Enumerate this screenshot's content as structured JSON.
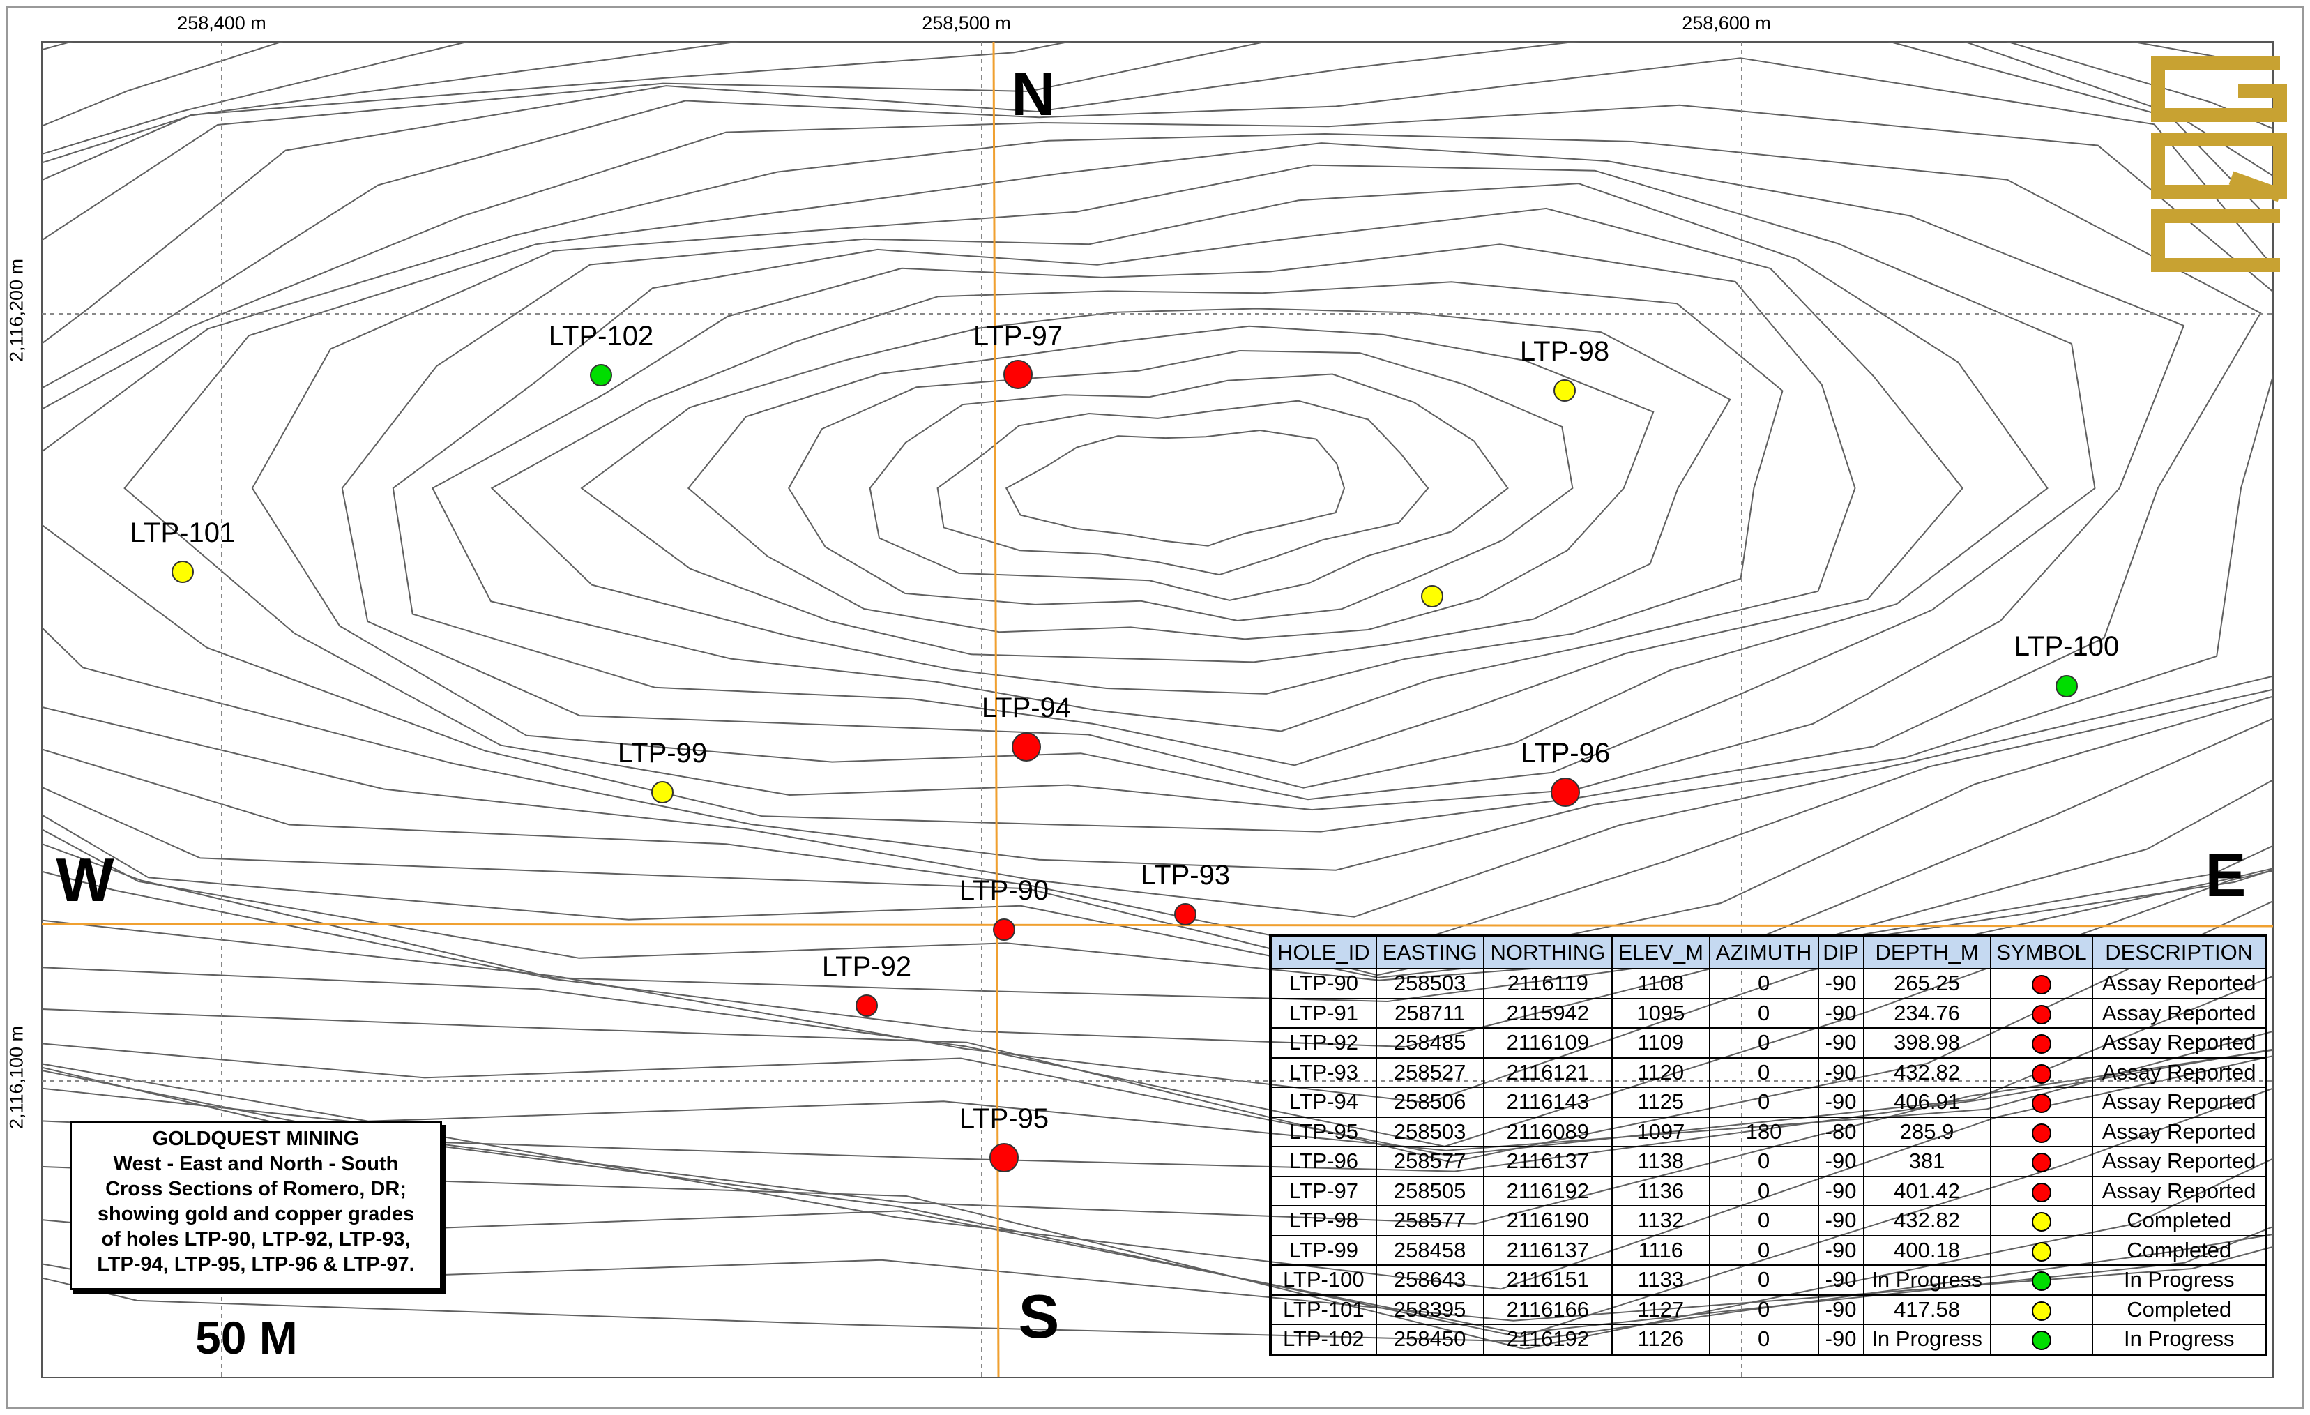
{
  "map": {
    "easting_ticks": [
      {
        "label": "258,400 m",
        "value": 258400
      },
      {
        "label": "258,500 m",
        "value": 258500
      },
      {
        "label": "258,600 m",
        "value": 258600
      }
    ],
    "northing_ticks": [
      {
        "label": "2,116,200 m",
        "value": 2116200
      },
      {
        "label": "2,116,100 m",
        "value": 2116100
      }
    ],
    "compass": {
      "north": "N",
      "south": "S",
      "east": "E",
      "west": "W"
    },
    "section_line_color": "#f0a030",
    "grid_line_color": "#888888",
    "contour_color": "#606060",
    "logo_letters": "GQC",
    "logo_color": "#c8a232",
    "scale_label": "50 M"
  },
  "legend": {
    "title": "GOLDQUEST MINING",
    "description": "West - East and North - South\nCross Sections of Romero, DR;\nshowing gold and copper grades\nof holes LTP-90, LTP-92, LTP-93,\nLTP-94, LTP-95, LTP-96 & LTP-97."
  },
  "symbol_colors": {
    "Assay Reported": "#ff0000",
    "Completed": "#ffff00",
    "In Progress": "#00dd00"
  },
  "map_holes": [
    {
      "label": "LTP-97",
      "status": "Assay Reported",
      "size": "large"
    },
    {
      "label": "LTP-102",
      "status": "In Progress",
      "size": "small"
    },
    {
      "label": "LTP-98",
      "status": "Completed",
      "size": "small"
    },
    {
      "label": "LTP-101",
      "status": "Completed",
      "size": "small"
    },
    {
      "label": "",
      "status": "Completed",
      "size": "small"
    },
    {
      "label": "LTP-100",
      "status": "In Progress",
      "size": "small"
    },
    {
      "label": "LTP-94",
      "status": "Assay Reported",
      "size": "large"
    },
    {
      "label": "LTP-96",
      "status": "Assay Reported",
      "size": "large"
    },
    {
      "label": "LTP-99",
      "status": "Completed",
      "size": "small"
    },
    {
      "label": "LTP-93",
      "status": "Assay Reported",
      "size": "small"
    },
    {
      "label": "LTP-90",
      "status": "Assay Reported",
      "size": "small"
    },
    {
      "label": "LTP-92",
      "status": "Assay Reported",
      "size": "small"
    },
    {
      "label": "LTP-95",
      "status": "Assay Reported",
      "size": "large"
    }
  ],
  "table": {
    "headers": [
      "HOLE_ID",
      "EASTING",
      "NORTHING",
      "ELEV_M",
      "AZIMUTH",
      "DIP",
      "DEPTH_M",
      "SYMBOL",
      "DESCRIPTION"
    ],
    "rows": [
      [
        "LTP-90",
        "258503",
        "2116119",
        "1108",
        "0",
        "-90",
        "265.25",
        "Assay Reported"
      ],
      [
        "LTP-91",
        "258711",
        "2115942",
        "1095",
        "0",
        "-90",
        "234.76",
        "Assay Reported"
      ],
      [
        "LTP-92",
        "258485",
        "2116109",
        "1109",
        "0",
        "-90",
        "398.98",
        "Assay Reported"
      ],
      [
        "LTP-93",
        "258527",
        "2116121",
        "1120",
        "0",
        "-90",
        "432.82",
        "Assay Reported"
      ],
      [
        "LTP-94",
        "258506",
        "2116143",
        "1125",
        "0",
        "-90",
        "406.91",
        "Assay Reported"
      ],
      [
        "LTP-95",
        "258503",
        "2116089",
        "1097",
        "180",
        "-80",
        "285.9",
        "Assay Reported"
      ],
      [
        "LTP-96",
        "258577",
        "2116137",
        "1138",
        "0",
        "-90",
        "381",
        "Assay Reported"
      ],
      [
        "LTP-97",
        "258505",
        "2116192",
        "1136",
        "0",
        "-90",
        "401.42",
        "Assay Reported"
      ],
      [
        "LTP-98",
        "258577",
        "2116190",
        "1132",
        "0",
        "-90",
        "432.82",
        "Completed"
      ],
      [
        "LTP-99",
        "258458",
        "2116137",
        "1116",
        "0",
        "-90",
        "400.18",
        "Completed"
      ],
      [
        "LTP-100",
        "258643",
        "2116151",
        "1133",
        "0",
        "-90",
        "In Progress",
        "In Progress"
      ],
      [
        "LTP-101",
        "258395",
        "2116166",
        "1127",
        "0",
        "-90",
        "417.58",
        "Completed"
      ],
      [
        "LTP-102",
        "258450",
        "2116192",
        "1126",
        "0",
        "-90",
        "In Progress",
        "In Progress"
      ]
    ]
  }
}
